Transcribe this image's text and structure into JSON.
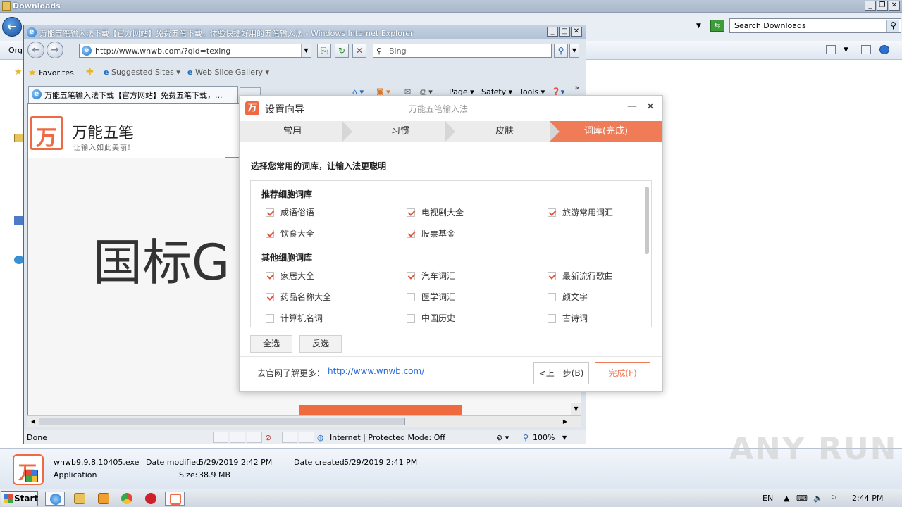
{
  "explorer": {
    "title": "Downloads",
    "search_placeholder": "Search Downloads",
    "organize_label": "Org",
    "file": {
      "name": "wnwb9.9.8.10405.exe",
      "modified_label": "Date modified:",
      "modified_value": "5/29/2019 2:42 PM",
      "created_label": "Date created:",
      "created_value": "5/29/2019 2:41 PM",
      "type": "Application",
      "size_label": "Size:",
      "size_value": "38.9 MB"
    },
    "watermark": "ANY RUN"
  },
  "ie": {
    "title": "万能五笔输入法下载【官方网站】免费五笔下载，体验快捷好用的五笔输入法 - Windows Internet Explorer",
    "url": "http://www.wnwb.com/?qid=texing",
    "search_placeholder": "Bing",
    "favorites_label": "Favorites",
    "suggested_sites": "Suggested Sites",
    "web_slice_gallery": "Web Slice Gallery",
    "tab_title": "万能五笔输入法下载【官方网站】免费五笔下载，...",
    "menu": {
      "page": "Page",
      "safety": "Safety",
      "tools": "Tools"
    },
    "status": {
      "done": "Done",
      "zone": "Internet | Protected Mode: Off",
      "zoom": "100%"
    },
    "site": {
      "name": "万能五笔",
      "slogan": "让输入如此美丽!",
      "banner_text": "国标G"
    }
  },
  "dialog": {
    "title": "设置向导",
    "subtitle": "万能五笔输入法",
    "steps": [
      "常用",
      "习惯",
      "皮肤",
      "词库(完成)"
    ],
    "active_step": 3,
    "intro": "选择您常用的词库，让输入法更聪明",
    "recommended": {
      "heading": "推荐细胞词库",
      "items": [
        {
          "label": "成语俗语",
          "checked": true
        },
        {
          "label": "电视剧大全",
          "checked": true
        },
        {
          "label": "旅游常用词汇",
          "checked": true
        },
        {
          "label": "饮食大全",
          "checked": true
        },
        {
          "label": "股票基金",
          "checked": true
        }
      ]
    },
    "other": {
      "heading": "其他细胞词库",
      "items": [
        {
          "label": "家居大全",
          "checked": true
        },
        {
          "label": "汽车词汇",
          "checked": true
        },
        {
          "label": "最新流行歌曲",
          "checked": true
        },
        {
          "label": "药品名称大全",
          "checked": true
        },
        {
          "label": "医学词汇",
          "checked": false
        },
        {
          "label": "颜文字",
          "checked": false
        },
        {
          "label": "计算机名词",
          "checked": false
        },
        {
          "label": "中国历史",
          "checked": false
        },
        {
          "label": "古诗词",
          "checked": false
        }
      ]
    },
    "select_all": "全选",
    "invert_selection": "反选",
    "more_text": "去官网了解更多：",
    "more_link": "http://www.wnwb.com/",
    "prev_button": "<上一步(B)",
    "finish_button": "完成(F)",
    "accent_color": "#f07b57"
  },
  "taskbar": {
    "start": "Start",
    "lang": "EN",
    "time": "2:44 PM"
  }
}
